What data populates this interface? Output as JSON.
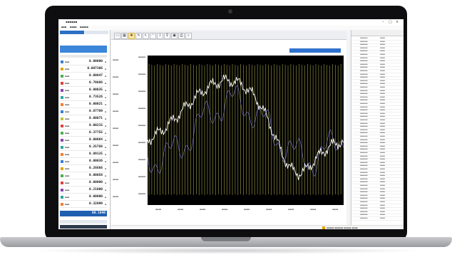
{
  "device": {
    "type": "laptop"
  },
  "left_panel": {
    "status_value": "00.1048",
    "channels": [
      {
        "color": "#3a7fd8",
        "value": "0.00000"
      },
      {
        "color": "#e0a400",
        "value": "0.007306"
      },
      {
        "color": "#4caf50",
        "value": "0.00047"
      },
      {
        "color": "#e04040",
        "value": "0.79886"
      },
      {
        "color": "#8e44ad",
        "value": "0.00035"
      },
      {
        "color": "#2ca7a0",
        "value": "0.73526"
      },
      {
        "color": "#f08030",
        "value": "0.00021"
      },
      {
        "color": "#3a7fd8",
        "value": "0.87789"
      },
      {
        "color": "#c0c040",
        "value": "0.00071"
      },
      {
        "color": "#e04040",
        "value": "0.00215"
      },
      {
        "color": "#4caf50",
        "value": "0.37755"
      },
      {
        "color": "#8e44ad",
        "value": "0.00064"
      },
      {
        "color": "#2ca7a0",
        "value": "0.25788"
      },
      {
        "color": "#f08030",
        "value": "0.89125"
      },
      {
        "color": "#3a7fd8",
        "value": "0.00036"
      },
      {
        "color": "#e0a400",
        "value": "0.26666"
      },
      {
        "color": "#4caf50",
        "value": "0.00058"
      },
      {
        "color": "#e04040",
        "value": "0.00000"
      },
      {
        "color": "#8e44ad",
        "value": "0.21000"
      },
      {
        "color": "#2ca7a0",
        "value": "0.00000"
      },
      {
        "color": "#f08030",
        "value": "0.32099"
      }
    ]
  },
  "toolbar": {
    "buttons": [
      {
        "icon": "zoom-fit-icon",
        "glyph": "▭"
      },
      {
        "icon": "zoom-window-icon",
        "glyph": "▦"
      },
      {
        "icon": "pan-icon",
        "glyph": "✥",
        "active": true
      },
      {
        "icon": "measure-icon",
        "glyph": "✎"
      },
      {
        "icon": "cursor-icon",
        "glyph": "↖"
      },
      {
        "icon": "marker-icon",
        "glyph": "◠"
      },
      {
        "icon": "export-icon",
        "glyph": "⇩"
      },
      {
        "icon": "filter-icon",
        "glyph": "⊽"
      },
      {
        "icon": "settings-icon",
        "glyph": "▣"
      },
      {
        "icon": "print-icon",
        "glyph": "⎙"
      },
      {
        "icon": "search-icon",
        "glyph": "⌕"
      }
    ]
  },
  "chart": {
    "colors": {
      "background": "#000000",
      "oscillation": "#d8d860",
      "signal_main": "#ffffff",
      "signal_secondary": "#8080e0"
    }
  }
}
